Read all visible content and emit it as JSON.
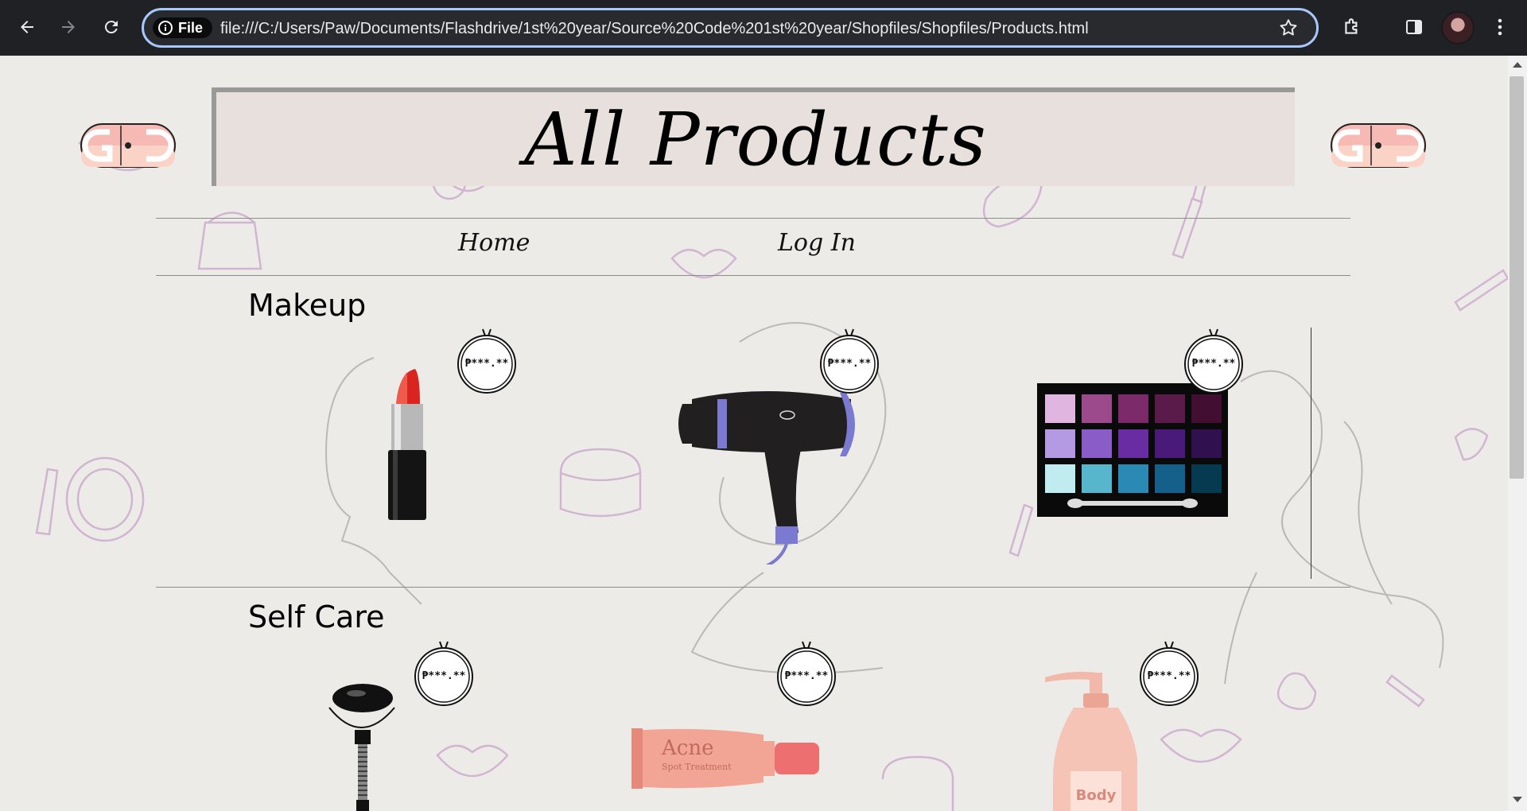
{
  "browser": {
    "chip_label": "File",
    "url": "file:///C:/Users/Paw/Documents/Flashdrive/1st%20year/Source%20Code%201st%20year/Shopfiles/Shopfiles/Products.html",
    "icons": [
      "back-icon",
      "forward-icon",
      "reload-icon",
      "info-icon",
      "star-icon",
      "extensions-icon",
      "sidepanel-icon",
      "avatar",
      "menu-icon"
    ]
  },
  "header": {
    "title": "All Products"
  },
  "nav": {
    "home": "Home",
    "login": "Log In"
  },
  "sections": [
    {
      "title": "Makeup",
      "products": [
        {
          "image": "lipstick",
          "price": "₱***.**"
        },
        {
          "image": "hair-dryer",
          "price": "₱***.**"
        },
        {
          "image": "eyeshadow-palette",
          "price": "₱***.**"
        }
      ]
    },
    {
      "title": "Self Care",
      "products": [
        {
          "image": "jade-roller",
          "price": "₱***.**"
        },
        {
          "image": "acne-cream",
          "price": "₱***.**",
          "label": "Acne",
          "sublabel": "Spot Treatment"
        },
        {
          "image": "body-lotion",
          "price": "₱***.**",
          "label": "Body"
        }
      ]
    }
  ],
  "colors": {
    "accent": "#a8c7fa",
    "doodle": "#c9a3c9",
    "banner": "#e8e0dc",
    "logo_pink": "#f6b9b3"
  }
}
